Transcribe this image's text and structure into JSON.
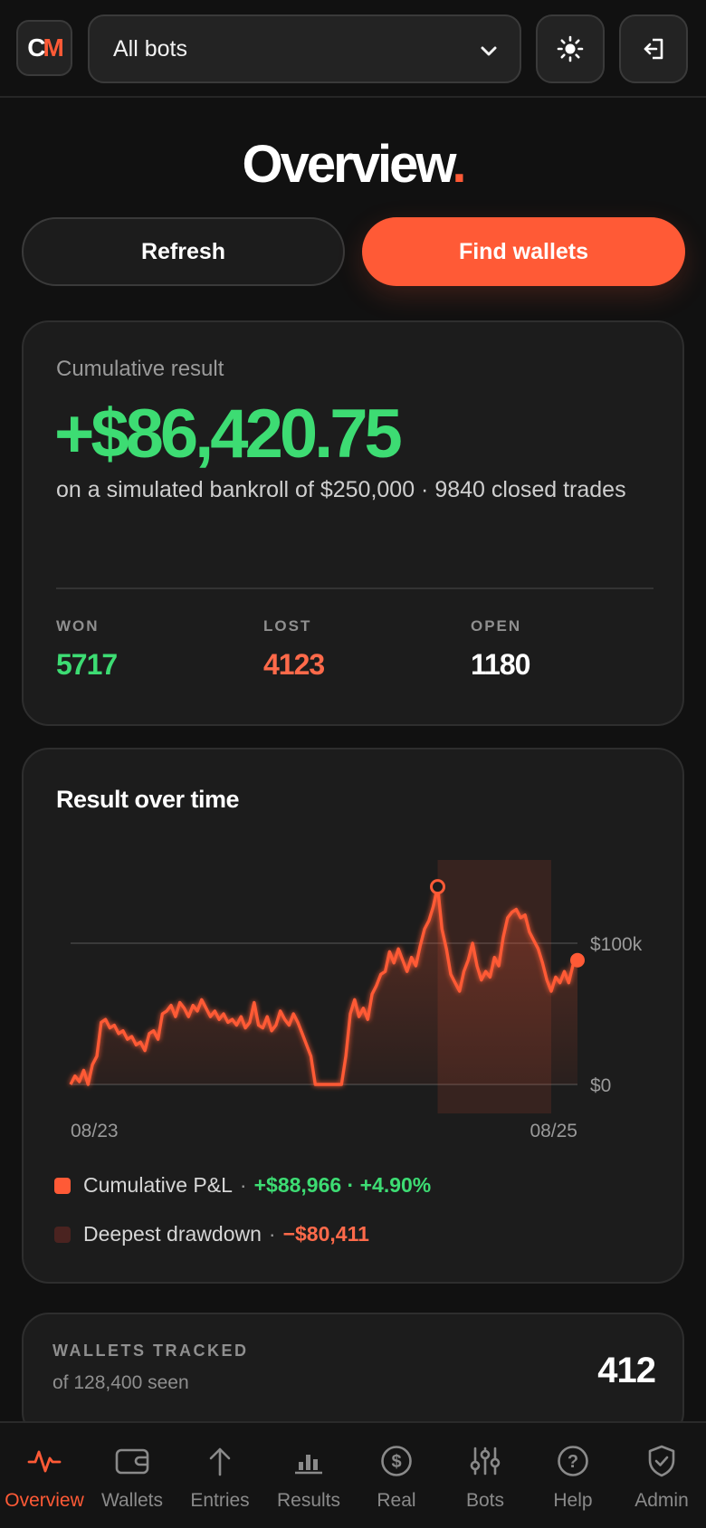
{
  "app": {
    "logo_text_c": "C",
    "logo_text_m": "M",
    "bot_selector": {
      "selected": "All bots",
      "options": [
        "All bots"
      ]
    }
  },
  "page": {
    "title": "Overview",
    "title_dot": "."
  },
  "actions": {
    "refresh_label": "Refresh",
    "find_wallets_label": "Find wallets"
  },
  "cumulative": {
    "label": "Cumulative result",
    "value": "+$86,420.75",
    "subtitle": "on a simulated bankroll of $250,000 · 9840 closed trades",
    "stats": {
      "won_label": "WON",
      "won_value": "5717",
      "lost_label": "LOST",
      "lost_value": "4123",
      "open_label": "OPEN",
      "open_value": "1180"
    }
  },
  "chart": {
    "title": "Result over time",
    "legend": {
      "pnl_label": "Cumulative P&L",
      "pnl_value": "+$88,966 · +4.90%",
      "drawdown_label": "Deepest drawdown",
      "drawdown_value": "−$80,411"
    }
  },
  "chart_data": {
    "type": "area",
    "title": "Result over time",
    "x_labels": [
      "08/23",
      "08/25"
    ],
    "y_tick_labels": [
      "$0",
      "$100k"
    ],
    "y_ticks": [
      0,
      100000
    ],
    "ylim": [
      -4000,
      140000
    ],
    "grid": true,
    "colors": {
      "line": "#ff5a36",
      "drawdown_band": "#ff5a36",
      "positive": "#3ddc73",
      "negative": "#ff6a4a"
    },
    "series": [
      {
        "name": "Cumulative P&L",
        "values": [
          0,
          6000,
          2000,
          10000,
          0,
          14000,
          20000,
          44000,
          46000,
          40000,
          42000,
          36000,
          38000,
          32000,
          34000,
          28000,
          30000,
          24000,
          36000,
          38000,
          32000,
          50000,
          52000,
          56000,
          48000,
          58000,
          54000,
          48000,
          56000,
          52000,
          60000,
          54000,
          48000,
          52000,
          46000,
          50000,
          44000,
          46000,
          42000,
          48000,
          40000,
          44000,
          58000,
          42000,
          40000,
          48000,
          38000,
          42000,
          52000,
          46000,
          42000,
          50000,
          44000,
          36000,
          28000,
          20000,
          0,
          0,
          0,
          0,
          0,
          0,
          0,
          20000,
          50000,
          60000,
          48000,
          54000,
          46000,
          64000,
          70000,
          78000,
          80000,
          94000,
          86000,
          96000,
          88000,
          80000,
          90000,
          84000,
          98000,
          110000,
          116000,
          126000,
          140000,
          110000,
          96000,
          78000,
          72000,
          66000,
          80000,
          88000,
          100000,
          84000,
          74000,
          80000,
          76000,
          90000,
          84000,
          104000,
          118000,
          122000,
          124000,
          118000,
          120000,
          108000,
          102000,
          96000,
          86000,
          74000,
          66000,
          76000,
          72000,
          80000,
          72000,
          85000,
          88000
        ]
      }
    ],
    "highlights": {
      "peak_index": 84,
      "drawdown_start_index": 84,
      "drawdown_end_index": 110,
      "end_value": 88000
    }
  },
  "wallets": {
    "label": "WALLETS TRACKED",
    "sub": "of 128,400 seen",
    "value": "412"
  },
  "nav": [
    {
      "label": "Overview",
      "icon": "pulse-icon",
      "active": true
    },
    {
      "label": "Wallets",
      "icon": "wallet-icon",
      "active": false
    },
    {
      "label": "Entries",
      "icon": "arrow-up-icon",
      "active": false
    },
    {
      "label": "Results",
      "icon": "bar-chart-icon",
      "active": false
    },
    {
      "label": "Real",
      "icon": "dollar-circle-icon",
      "active": false
    },
    {
      "label": "Bots",
      "icon": "sliders-icon",
      "active": false
    },
    {
      "label": "Help",
      "icon": "help-circle-icon",
      "active": false
    },
    {
      "label": "Admin",
      "icon": "shield-check-icon",
      "active": false
    }
  ]
}
